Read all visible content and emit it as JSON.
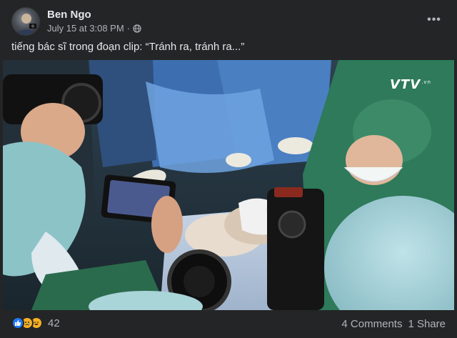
{
  "post": {
    "author": "Ben Ngo",
    "timestamp": "July 15 at 3:08 PM",
    "audience_icon": "globe-icon",
    "more_icon": "more-options-icon",
    "more_label": "•••",
    "caption": "tiếng bác sĩ trong đoạn clip: “Tránh ra, tránh ra...”",
    "media": {
      "logo_text": "VTV",
      "logo_suffix": ".vn"
    },
    "reactions": {
      "icons": [
        "like-icon",
        "sad-icon",
        "haha-icon"
      ],
      "count": "42"
    },
    "comments": "4 Comments",
    "shares": "1 Share"
  },
  "colors": {
    "card_bg": "#242526",
    "text_primary": "#e4e6eb",
    "text_secondary": "#b0b3b8",
    "like_blue": "#2078f4",
    "reaction_yellow": "#f7b125"
  }
}
